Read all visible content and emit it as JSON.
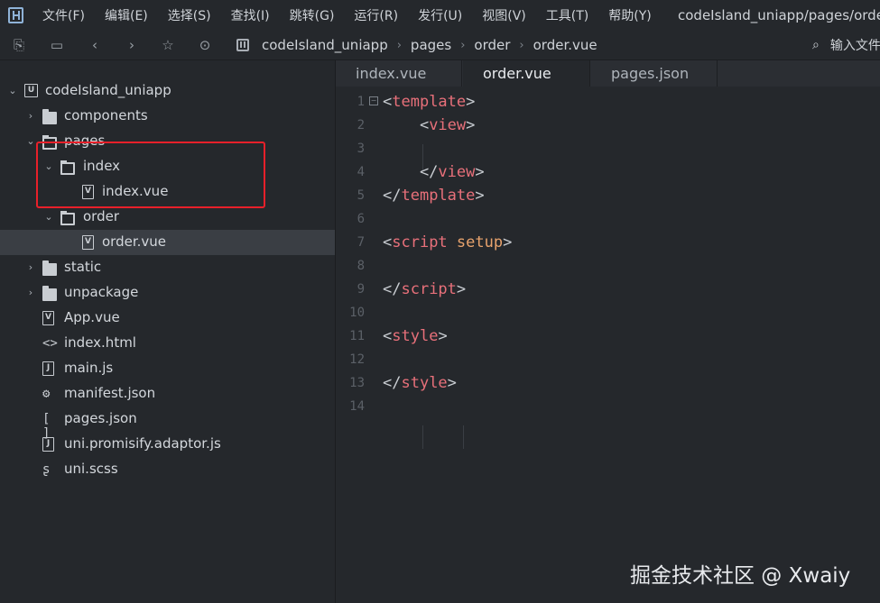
{
  "menubar": {
    "items": [
      "文件(F)",
      "编辑(E)",
      "选择(S)",
      "查找(I)",
      "跳转(G)",
      "运行(R)",
      "发行(U)",
      "视图(V)",
      "工具(T)",
      "帮助(Y)"
    ],
    "window_path": "codeIsland_uniapp/pages/order/order.vue"
  },
  "toolbar": {
    "breadcrumb": [
      "codeIsland_uniapp",
      "pages",
      "order",
      "order.vue"
    ],
    "search_placeholder": "输入文件名",
    "sep": "›"
  },
  "sidebar": {
    "tree": [
      {
        "label": "codeIsland_uniapp",
        "icon": "project-icon",
        "expanded": true
      },
      {
        "label": "components",
        "icon": "folder-icon",
        "expanded": false
      },
      {
        "label": "pages",
        "icon": "folder-open-icon",
        "expanded": true
      },
      {
        "label": "index",
        "icon": "folder-open-icon",
        "expanded": true
      },
      {
        "label": "index.vue",
        "icon": "vue-file-icon"
      },
      {
        "label": "order",
        "icon": "folder-open-icon",
        "expanded": true
      },
      {
        "label": "order.vue",
        "icon": "vue-file-icon",
        "selected": true
      },
      {
        "label": "static",
        "icon": "folder-icon",
        "expanded": false
      },
      {
        "label": "unpackage",
        "icon": "folder-icon",
        "expanded": false
      },
      {
        "label": "App.vue",
        "icon": "vue-file-icon"
      },
      {
        "label": "index.html",
        "icon": "html-file-icon"
      },
      {
        "label": "main.js",
        "icon": "js-file-icon"
      },
      {
        "label": "manifest.json",
        "icon": "manifest-file-icon"
      },
      {
        "label": "pages.json",
        "icon": "json-file-icon"
      },
      {
        "label": "uni.promisify.adaptor.js",
        "icon": "js-file-icon"
      },
      {
        "label": "uni.scss",
        "icon": "scss-file-icon"
      }
    ]
  },
  "editor": {
    "tabs": [
      {
        "label": "index.vue",
        "active": false
      },
      {
        "label": "order.vue",
        "active": true
      },
      {
        "label": "pages.json",
        "active": false
      }
    ],
    "lines": [
      {
        "no": "1",
        "tokens": [
          [
            "br",
            "<"
          ],
          [
            "tag",
            "template"
          ],
          [
            "br",
            ">"
          ]
        ]
      },
      {
        "no": "2",
        "tokens": [
          [
            "br",
            "    <"
          ],
          [
            "tag",
            "view"
          ],
          [
            "br",
            ">"
          ]
        ]
      },
      {
        "no": "3",
        "tokens": []
      },
      {
        "no": "4",
        "tokens": [
          [
            "br",
            "    </"
          ],
          [
            "tag",
            "view"
          ],
          [
            "br",
            ">"
          ]
        ]
      },
      {
        "no": "5",
        "tokens": [
          [
            "br",
            "</"
          ],
          [
            "tag",
            "template"
          ],
          [
            "br",
            ">"
          ]
        ]
      },
      {
        "no": "6",
        "tokens": []
      },
      {
        "no": "7",
        "tokens": [
          [
            "br",
            "<"
          ],
          [
            "tag",
            "script"
          ],
          [
            "br",
            " "
          ],
          [
            "attr",
            "setup"
          ],
          [
            "br",
            ">"
          ]
        ]
      },
      {
        "no": "8",
        "tokens": []
      },
      {
        "no": "9",
        "tokens": [
          [
            "br",
            "</"
          ],
          [
            "tag",
            "script"
          ],
          [
            "br",
            ">"
          ]
        ]
      },
      {
        "no": "10",
        "tokens": []
      },
      {
        "no": "11",
        "tokens": [
          [
            "br",
            "<"
          ],
          [
            "tag",
            "style"
          ],
          [
            "br",
            ">"
          ]
        ]
      },
      {
        "no": "12",
        "tokens": []
      },
      {
        "no": "13",
        "tokens": [
          [
            "br",
            "</"
          ],
          [
            "tag",
            "style"
          ],
          [
            "br",
            ">"
          ]
        ]
      },
      {
        "no": "14",
        "tokens": []
      }
    ]
  },
  "watermark": "掘金技术社区 @ Xwaiy",
  "colors": {
    "tag": "#e8707a",
    "attr": "#e8a36d",
    "highlight": "#e8202a"
  }
}
